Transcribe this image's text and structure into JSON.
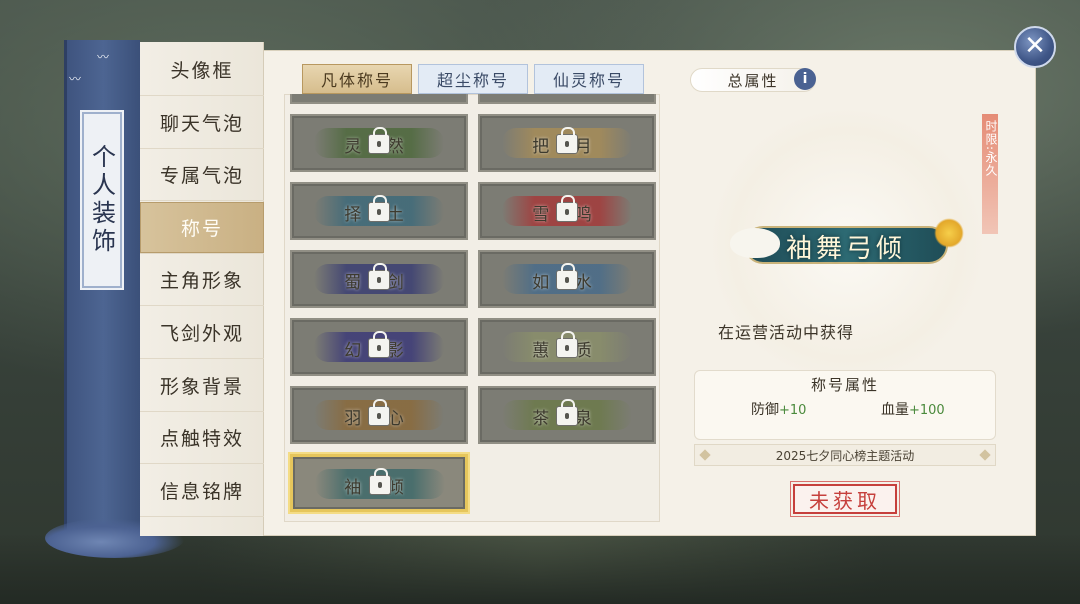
{
  "panel": {
    "side_label": "个人装饰"
  },
  "close": {
    "icon": "close-icon"
  },
  "nav": {
    "items": [
      {
        "label": "头像框"
      },
      {
        "label": "聊天气泡"
      },
      {
        "label": "专属气泡"
      },
      {
        "label": "称号",
        "active": true
      },
      {
        "label": "主角形象"
      },
      {
        "label": "飞剑外观"
      },
      {
        "label": "形象背景"
      },
      {
        "label": "点触特效"
      },
      {
        "label": "信息铭牌"
      }
    ]
  },
  "tabs": [
    {
      "label": "凡体称号",
      "active": true
    },
    {
      "label": "超尘称号"
    },
    {
      "label": "仙灵称号"
    }
  ],
  "titles": [
    {
      "text": "灵 然",
      "banner": "#4f6a3e",
      "locked": true
    },
    {
      "text": "把 月",
      "banner": "#a68c58",
      "locked": true
    },
    {
      "text": "择 土",
      "banner": "#3e6a7a",
      "locked": true
    },
    {
      "text": "雪 鸣",
      "banner": "#a43a3a",
      "locked": true
    },
    {
      "text": "蜀 剑",
      "banner": "#3b3f73",
      "locked": true
    },
    {
      "text": "如 水",
      "banner": "#496c8a",
      "locked": true
    },
    {
      "text": "幻 影",
      "banner": "#3c3a78",
      "locked": true
    },
    {
      "text": "蕙 质",
      "banner": "#8a8f6a",
      "locked": true
    },
    {
      "text": "羽 心",
      "banner": "#8a6a3c",
      "locked": true
    },
    {
      "text": "茶 泉",
      "banner": "#6c7a4a",
      "locked": true
    },
    {
      "text": "袖 倾",
      "banner": "#3f6a6a",
      "locked": true,
      "selected": true
    }
  ],
  "detail": {
    "total_attr_label": "总属性",
    "info_icon": "info-icon",
    "duration": "时限:永久",
    "title_name": "袖舞弓倾",
    "obtain_method": "在运营活动中获得",
    "attr_title": "称号属性",
    "stats": [
      {
        "name": "防御",
        "value": "+10"
      },
      {
        "name": "血量",
        "value": "+100"
      }
    ],
    "event_name": "2025七夕同心榜主题活动",
    "status_stamp": "未获取"
  }
}
